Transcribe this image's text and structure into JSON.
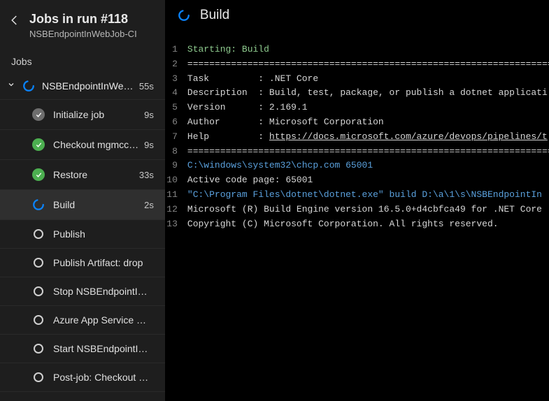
{
  "header": {
    "title": "Jobs in run #118",
    "subtitle": "NSBEndpointInWebJob-CI"
  },
  "section_label": "Jobs",
  "job": {
    "name": "NSBEndpointInWe…",
    "duration": "55s",
    "status": "running"
  },
  "steps": [
    {
      "status": "done",
      "label": "Initialize job",
      "duration": "9s"
    },
    {
      "status": "success",
      "label": "Checkout mgmcc…",
      "duration": "9s"
    },
    {
      "status": "success",
      "label": "Restore",
      "duration": "33s"
    },
    {
      "status": "running",
      "label": "Build",
      "duration": "2s",
      "selected": true
    },
    {
      "status": "pending",
      "label": "Publish",
      "duration": ""
    },
    {
      "status": "pending",
      "label": "Publish Artifact: drop",
      "duration": ""
    },
    {
      "status": "pending",
      "label": "Stop NSBEndpointI…",
      "duration": ""
    },
    {
      "status": "pending",
      "label": "Azure App Service …",
      "duration": ""
    },
    {
      "status": "pending",
      "label": "Start NSBEndpointI…",
      "duration": ""
    },
    {
      "status": "pending",
      "label": "Post-job: Checkout …",
      "duration": ""
    }
  ],
  "main": {
    "title": "Build"
  },
  "log": [
    {
      "n": 1,
      "cls": "c-green",
      "text": "Starting: Build"
    },
    {
      "n": 2,
      "cls": "c-white",
      "text": "=============================================================================="
    },
    {
      "n": 3,
      "cls": "c-white",
      "text": "Task         : .NET Core"
    },
    {
      "n": 4,
      "cls": "c-white",
      "text": "Description  : Build, test, package, or publish a dotnet applicati"
    },
    {
      "n": 5,
      "cls": "c-white",
      "text": "Version      : 2.169.1"
    },
    {
      "n": 6,
      "cls": "c-white",
      "text": "Author       : Microsoft Corporation"
    },
    {
      "n": 7,
      "cls": "c-white",
      "text": "Help         : ",
      "link": "https://docs.microsoft.com/azure/devops/pipelines/t"
    },
    {
      "n": 8,
      "cls": "c-white",
      "text": "=============================================================================="
    },
    {
      "n": 9,
      "cls": "c-blue",
      "text": "C:\\windows\\system32\\chcp.com 65001"
    },
    {
      "n": 10,
      "cls": "c-white",
      "text": "Active code page: 65001"
    },
    {
      "n": 11,
      "cls": "c-blue",
      "text": "\"C:\\Program Files\\dotnet\\dotnet.exe\" build D:\\a\\1\\s\\NSBEndpointIn"
    },
    {
      "n": 12,
      "cls": "c-white",
      "text": "Microsoft (R) Build Engine version 16.5.0+d4cbfca49 for .NET Core"
    },
    {
      "n": 13,
      "cls": "c-white",
      "text": "Copyright (C) Microsoft Corporation. All rights reserved."
    }
  ]
}
